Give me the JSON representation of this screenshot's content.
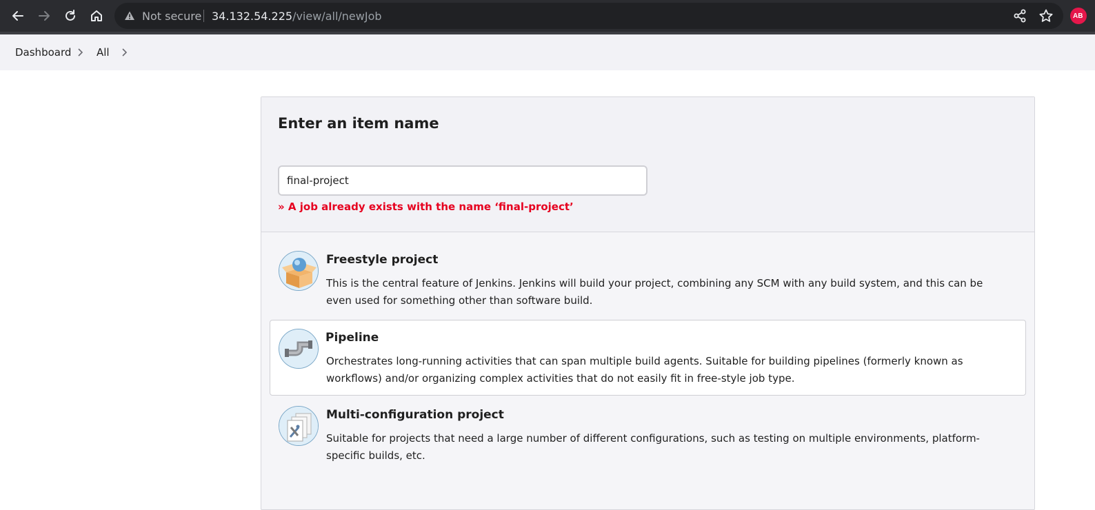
{
  "browser": {
    "security_label": "Not secure",
    "url_host": "34.132.54.225",
    "url_path": "/view/all/newJob",
    "extension_badge": "AB",
    "icons": [
      "back-icon",
      "forward-icon",
      "reload-icon",
      "home-icon",
      "warning-icon",
      "share-icon",
      "star-icon"
    ]
  },
  "breadcrumb": {
    "items": [
      {
        "label": "Dashboard"
      },
      {
        "label": "All"
      }
    ]
  },
  "form": {
    "heading": "Enter an item name",
    "name_value": "final-project",
    "error": "» A job already exists with the name ‘final-project’"
  },
  "job_types": [
    {
      "title": "Freestyle project",
      "description": "This is the central feature of Jenkins. Jenkins will build your project, combining any SCM with any build system, and this can be even used for something other than software build.",
      "icon": "freestyle-project-icon"
    },
    {
      "title": "Pipeline",
      "description": "Orchestrates long-running activities that can span multiple build agents. Suitable for building pipelines (formerly known as workflows) and/or organizing complex activities that do not easily fit in free-style job type.",
      "icon": "pipeline-icon",
      "selected": true
    },
    {
      "title": "Multi-configuration project",
      "description": "Suitable for projects that need a large number of different configurations, such as testing on multiple environments, platform-specific builds, etc.",
      "icon": "multi-configuration-icon"
    }
  ],
  "colors": {
    "error": "#e6001f",
    "chrome_bg": "#2b2c30",
    "breadcrumb_bg": "#f2f2f6"
  }
}
